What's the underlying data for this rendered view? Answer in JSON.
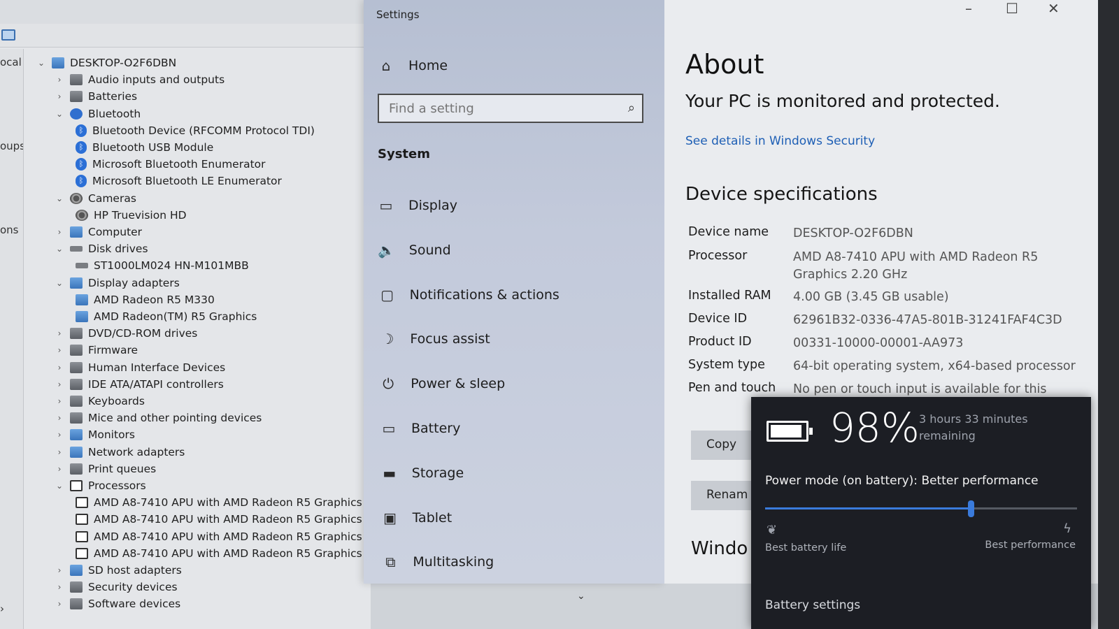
{
  "device_manager": {
    "left_pane_labels": [
      "ocal",
      "oups",
      "ons"
    ],
    "tree": [
      {
        "label": "DESKTOP-O2F6DBN",
        "level": 0,
        "expanded": true,
        "icon": "computer"
      },
      {
        "label": "Audio inputs and outputs",
        "level": 1,
        "expanded": false,
        "icon": "gray"
      },
      {
        "label": "Batteries",
        "level": 1,
        "expanded": false,
        "icon": "gray"
      },
      {
        "label": "Bluetooth",
        "level": 1,
        "expanded": true,
        "icon": "blue"
      },
      {
        "label": "Bluetooth Device (RFCOMM Protocol TDI)",
        "level": 2,
        "icon": "bt"
      },
      {
        "label": "Bluetooth USB Module",
        "level": 2,
        "icon": "bt"
      },
      {
        "label": "Microsoft Bluetooth Enumerator",
        "level": 2,
        "icon": "bt"
      },
      {
        "label": "Microsoft Bluetooth LE Enumerator",
        "level": 2,
        "icon": "bt"
      },
      {
        "label": "Cameras",
        "level": 1,
        "expanded": true,
        "icon": "cam"
      },
      {
        "label": "HP Truevision HD",
        "level": 2,
        "icon": "cam"
      },
      {
        "label": "Computer",
        "level": 1,
        "expanded": false,
        "icon": "computer"
      },
      {
        "label": "Disk drives",
        "level": 1,
        "expanded": true,
        "icon": "disk"
      },
      {
        "label": "ST1000LM024 HN-M101MBB",
        "level": 2,
        "icon": "disk"
      },
      {
        "label": "Display adapters",
        "level": 1,
        "expanded": true,
        "icon": "computer"
      },
      {
        "label": "AMD Radeon R5 M330",
        "level": 2,
        "icon": "computer"
      },
      {
        "label": "AMD Radeon(TM) R5 Graphics",
        "level": 2,
        "icon": "computer"
      },
      {
        "label": "DVD/CD-ROM drives",
        "level": 1,
        "expanded": false,
        "icon": "gray"
      },
      {
        "label": "Firmware",
        "level": 1,
        "expanded": false,
        "icon": "gray"
      },
      {
        "label": "Human Interface Devices",
        "level": 1,
        "expanded": false,
        "icon": "gray"
      },
      {
        "label": "IDE ATA/ATAPI controllers",
        "level": 1,
        "expanded": false,
        "icon": "gray"
      },
      {
        "label": "Keyboards",
        "level": 1,
        "expanded": false,
        "icon": "gray"
      },
      {
        "label": "Mice and other pointing devices",
        "level": 1,
        "expanded": false,
        "icon": "gray"
      },
      {
        "label": "Monitors",
        "level": 1,
        "expanded": false,
        "icon": "computer"
      },
      {
        "label": "Network adapters",
        "level": 1,
        "expanded": false,
        "icon": "computer"
      },
      {
        "label": "Print queues",
        "level": 1,
        "expanded": false,
        "icon": "gray"
      },
      {
        "label": "Processors",
        "level": 1,
        "expanded": true,
        "icon": "chip"
      },
      {
        "label": "AMD A8-7410 APU with AMD Radeon R5 Graphics",
        "level": 2,
        "icon": "chip"
      },
      {
        "label": "AMD A8-7410 APU with AMD Radeon R5 Graphics",
        "level": 2,
        "icon": "chip"
      },
      {
        "label": "AMD A8-7410 APU with AMD Radeon R5 Graphics",
        "level": 2,
        "icon": "chip"
      },
      {
        "label": "AMD A8-7410 APU with AMD Radeon R5 Graphics",
        "level": 2,
        "icon": "chip"
      },
      {
        "label": "SD host adapters",
        "level": 1,
        "expanded": false,
        "icon": "computer"
      },
      {
        "label": "Security devices",
        "level": 1,
        "expanded": false,
        "icon": "gray"
      },
      {
        "label": "Software devices",
        "level": 1,
        "expanded": false,
        "icon": "gray"
      }
    ]
  },
  "settings": {
    "window_title": "Settings",
    "home_label": "Home",
    "search_placeholder": "Find a setting",
    "section_heading": "System",
    "nav_items": [
      {
        "label": "Display",
        "icon": "monitor-icon"
      },
      {
        "label": "Sound",
        "icon": "speaker-icon"
      },
      {
        "label": "Notifications & actions",
        "icon": "message-icon"
      },
      {
        "label": "Focus assist",
        "icon": "moon-icon"
      },
      {
        "label": "Power & sleep",
        "icon": "power-icon"
      },
      {
        "label": "Battery",
        "icon": "battery-icon"
      },
      {
        "label": "Storage",
        "icon": "storage-icon"
      },
      {
        "label": "Tablet",
        "icon": "tablet-icon"
      },
      {
        "label": "Multitasking",
        "icon": "multitasking-icon"
      }
    ]
  },
  "about": {
    "title": "About",
    "protection_text": "Your PC is monitored and protected.",
    "security_link": "See details in Windows Security",
    "specs_heading": "Device specifications",
    "specs": [
      {
        "key": "Device name",
        "value": "DESKTOP-O2F6DBN"
      },
      {
        "key": "Processor",
        "value": "AMD A8-7410 APU with AMD Radeon R5 Graphics      2.20 GHz"
      },
      {
        "key": "Installed RAM",
        "value": "4.00 GB (3.45 GB usable)"
      },
      {
        "key": "Device ID",
        "value": "62961B32-0336-47A5-801B-31241FAF4C3D"
      },
      {
        "key": "Product ID",
        "value": "00331-10000-00001-AA973"
      },
      {
        "key": "System type",
        "value": "64-bit operating system, x64-based processor"
      },
      {
        "key": "Pen and touch",
        "value": "No pen or touch input is available for this"
      }
    ],
    "copy_button": "Copy",
    "rename_button": "Renam",
    "windows_heading": "Windo"
  },
  "battery_flyout": {
    "percent": "98%",
    "remaining": "3 hours 33 minutes remaining",
    "power_mode": "Power mode (on battery): Better performance",
    "slider_value": 0.66,
    "left_label": "Best battery life",
    "right_label": "Best performance",
    "settings_link": "Battery settings",
    "accent_color": "#3a7bdc"
  },
  "window_controls": {
    "minimize": "–",
    "maximize": "☐",
    "close": "✕"
  }
}
